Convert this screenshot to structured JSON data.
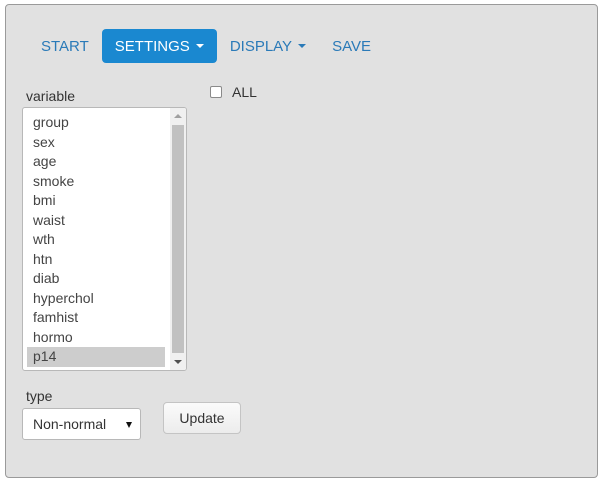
{
  "nav": {
    "start": "START",
    "settings": "SETTINGS",
    "display": "DISPLAY",
    "save": "SAVE"
  },
  "variable_label": "variable",
  "all_label": "ALL",
  "variables": [
    "group",
    "sex",
    "age",
    "smoke",
    "bmi",
    "waist",
    "wth",
    "htn",
    "diab",
    "hyperchol",
    "famhist",
    "hormo",
    "p14"
  ],
  "selected_variable": "p14",
  "type_label": "type",
  "type_value": "Non-normal",
  "update_button": "Update",
  "colors": {
    "accent": "#1a88d0",
    "link": "#2a7ab8",
    "panel_bg": "#e1e1e1"
  }
}
